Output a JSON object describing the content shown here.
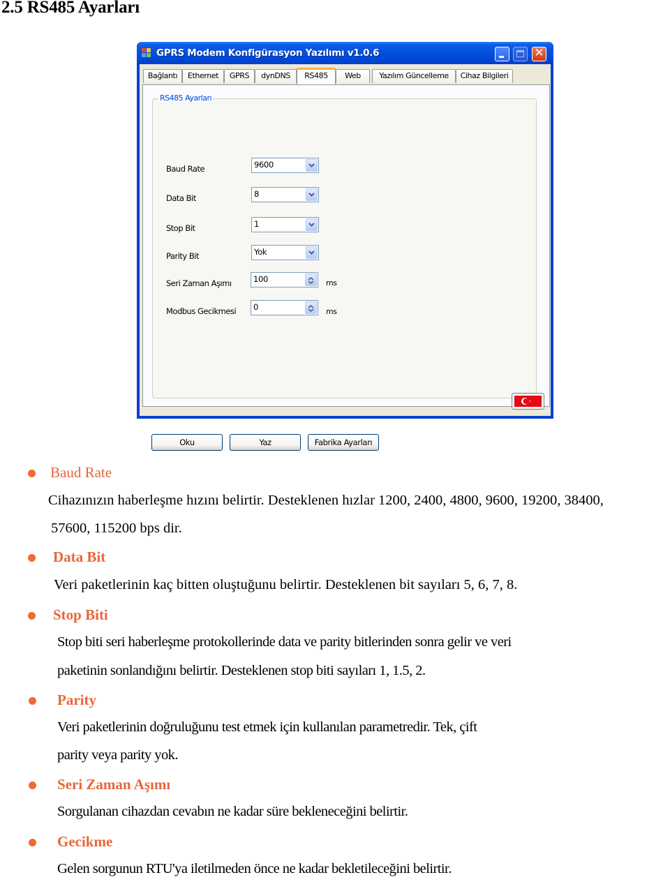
{
  "doc_title": "2.5 RS485 Ayarları",
  "window": {
    "title": "GPRS Modem Konfigürasyon Yazılımı v1.0.6",
    "controls": [
      "minimize",
      "maximize",
      "close"
    ],
    "tabs": [
      {
        "label": "Bağlantı",
        "active": false
      },
      {
        "label": "Ethernet",
        "active": false
      },
      {
        "label": "GPRS",
        "active": false
      },
      {
        "label": "dynDNS",
        "active": false
      },
      {
        "label": "RS485",
        "active": true
      },
      {
        "label": "Web",
        "active": false
      },
      {
        "label": "Yazılım Güncelleme",
        "active": false
      },
      {
        "label": "Cihaz Bilgileri",
        "active": false
      }
    ],
    "group_title": "RS485 Ayarları",
    "fields": [
      {
        "label": "Baud Rate",
        "type": "combo",
        "value": "9600"
      },
      {
        "label": "Data Bit",
        "type": "combo",
        "value": "8"
      },
      {
        "label": "Stop Bit",
        "type": "combo",
        "value": "1"
      },
      {
        "label": "Parity Bit",
        "type": "combo",
        "value": "Yok"
      },
      {
        "label": "Seri Zaman Aşımı",
        "type": "spinner",
        "value": "100",
        "unit": "ms"
      },
      {
        "label": "Modbus Gecikmesi",
        "type": "spinner",
        "value": "0",
        "unit": "ms"
      }
    ],
    "buttons": {
      "read": "Oku",
      "write": "Yaz",
      "factory": "Fabrika Ayarları"
    },
    "language_flag": "turkey-flag-icon"
  },
  "sections": [
    {
      "heading": "Baud Rate",
      "lines": [
        "Cihazınızın haberleşme hızını belirtir. Desteklenen hızlar 1200, 2400, 4800, 9600, 19200, 38400,",
        "57600, 115200 bps dir."
      ]
    },
    {
      "heading": "Data Bit",
      "lines": [
        "Veri paketlerinin kaç bitten oluştuğunu belirtir. Desteklenen bit sayıları 5, 6, 7, 8."
      ]
    },
    {
      "heading": "Stop Biti",
      "lines": [
        "Stop biti seri haberleşme protokollerinde data ve parity bitlerinden sonra gelir ve veri",
        "paketinin sonlandığını belirtir. Desteklenen stop biti sayıları 1, 1.5,  2."
      ]
    },
    {
      "heading": "Parity",
      "lines": [
        "Veri paketlerinin doğruluğunu test etmek  için kullanılan parametredir.  Tek, çift",
        "parity veya  parity yok."
      ]
    },
    {
      "heading": "Seri Zaman Aşımı",
      "lines": [
        "Sorgulanan cihazdan  cevabın ne kadar süre bekleneceğini belirtir."
      ]
    },
    {
      "heading": "Gecikme",
      "lines": [
        "Gelen sorgunun RTU'ya iletilmeden önce ne kadar bekletileceğini belirtir."
      ]
    }
  ],
  "colors": {
    "heading_accent": "#e8673a",
    "titlebar_blue": "#0552e0",
    "active_tab_accent": "#f3b343"
  }
}
